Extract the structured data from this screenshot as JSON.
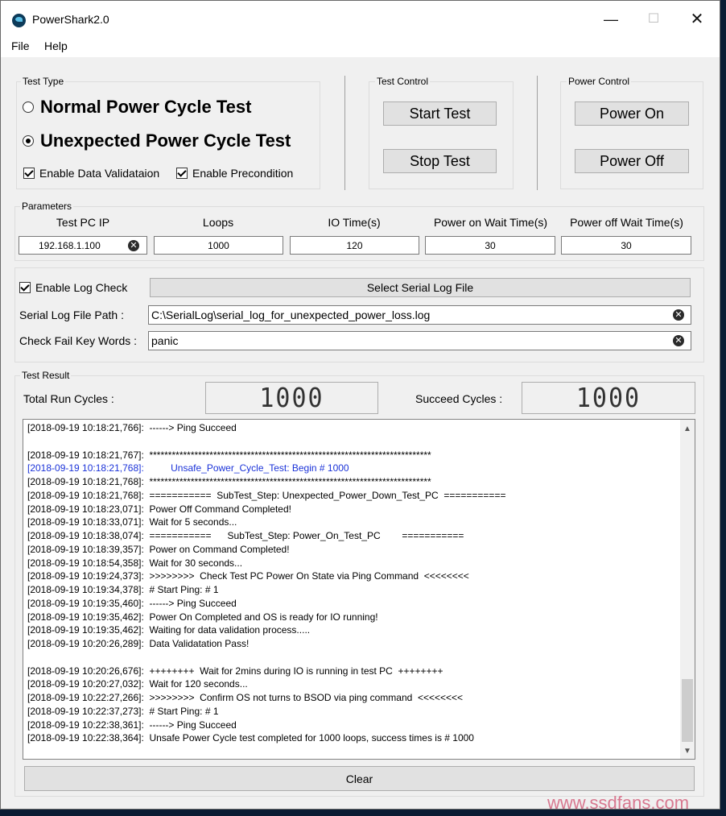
{
  "window": {
    "title": "PowerShark2.0",
    "minimize": "—",
    "maximize": "☐",
    "close": "✕"
  },
  "menu": {
    "file": "File",
    "help": "Help"
  },
  "test_type": {
    "label": "Test Type",
    "normal": "Normal Power Cycle Test",
    "unexpected": "Unexpected Power Cycle Test",
    "selected": "unexpected",
    "data_validation": "Enable Data Validataion",
    "precondition": "Enable Precondition"
  },
  "test_control": {
    "label": "Test Control",
    "start": "Start Test",
    "stop": "Stop Test"
  },
  "power_control": {
    "label": "Power Control",
    "on": "Power On",
    "off": "Power Off"
  },
  "parameters": {
    "label": "Parameters",
    "headers": [
      "Test PC IP",
      "Loops",
      "IO Time(s)",
      "Power on Wait Time(s)",
      "Power off Wait Time(s)"
    ],
    "values": [
      "192.168.1.100",
      "1000",
      "120",
      "30",
      "30"
    ]
  },
  "log_check": {
    "enable": "Enable Log Check",
    "select_button": "Select Serial Log File",
    "path_label": "Serial Log File Path :",
    "path_value": "C:\\SerialLog\\serial_log_for_unexpected_power_loss.log",
    "keywords_label": "Check Fail Key Words :",
    "keywords_value": "panic"
  },
  "test_result": {
    "label": "Test Result",
    "total_label": "Total Run Cycles :",
    "total_value": "1000",
    "succeed_label": "Succeed Cycles :",
    "succeed_value": "1000"
  },
  "log": [
    {
      "text": "[2018-09-19 10:18:21,766]:  ------> Ping Succeed"
    },
    {
      "text": ""
    },
    {
      "text": "[2018-09-19 10:18:21,767]:  ***************************************************************************"
    },
    {
      "text": "[2018-09-19 10:18:21,768]:          Unsafe_Power_Cycle_Test: Begin # 1000",
      "blue": true
    },
    {
      "text": "[2018-09-19 10:18:21,768]:  ***************************************************************************"
    },
    {
      "text": "[2018-09-19 10:18:21,768]:  ===========  SubTest_Step: Unexpected_Power_Down_Test_PC  ==========="
    },
    {
      "text": "[2018-09-19 10:18:23,071]:  Power Off Command Completed!"
    },
    {
      "text": "[2018-09-19 10:18:33,071]:  Wait for 5 seconds..."
    },
    {
      "text": "[2018-09-19 10:18:38,074]:  ===========      SubTest_Step: Power_On_Test_PC        ==========="
    },
    {
      "text": "[2018-09-19 10:18:39,357]:  Power on Command Completed!"
    },
    {
      "text": "[2018-09-19 10:18:54,358]:  Wait for 30 seconds..."
    },
    {
      "text": "[2018-09-19 10:19:24,373]:  >>>>>>>>  Check Test PC Power On State via Ping Command  <<<<<<<<"
    },
    {
      "text": "[2018-09-19 10:19:34,378]:  # Start Ping: # 1"
    },
    {
      "text": "[2018-09-19 10:19:35,460]:  ------> Ping Succeed"
    },
    {
      "text": "[2018-09-19 10:19:35,462]:  Power On Completed and OS is ready for IO running!"
    },
    {
      "text": "[2018-09-19 10:19:35,462]:  Waiting for data validation process....."
    },
    {
      "text": "[2018-09-19 10:20:26,289]:  Data Validatation Pass!"
    },
    {
      "text": ""
    },
    {
      "text": "[2018-09-19 10:20:26,676]:  ++++++++  Wait for 2mins during IO is running in test PC  ++++++++"
    },
    {
      "text": "[2018-09-19 10:20:27,032]:  Wait for 120 seconds..."
    },
    {
      "text": "[2018-09-19 10:22:27,266]:  >>>>>>>>  Confirm OS not turns to BSOD via ping command  <<<<<<<<"
    },
    {
      "text": "[2018-09-19 10:22:37,273]:  # Start Ping: # 1"
    },
    {
      "text": "[2018-09-19 10:22:38,361]:  ------> Ping Succeed"
    },
    {
      "text": "[2018-09-19 10:22:38,364]:  Unsafe Power Cycle test completed for 1000 loops, success times is # 1000"
    }
  ],
  "clear_button": "Clear",
  "watermark": "www.ssdfans.com"
}
